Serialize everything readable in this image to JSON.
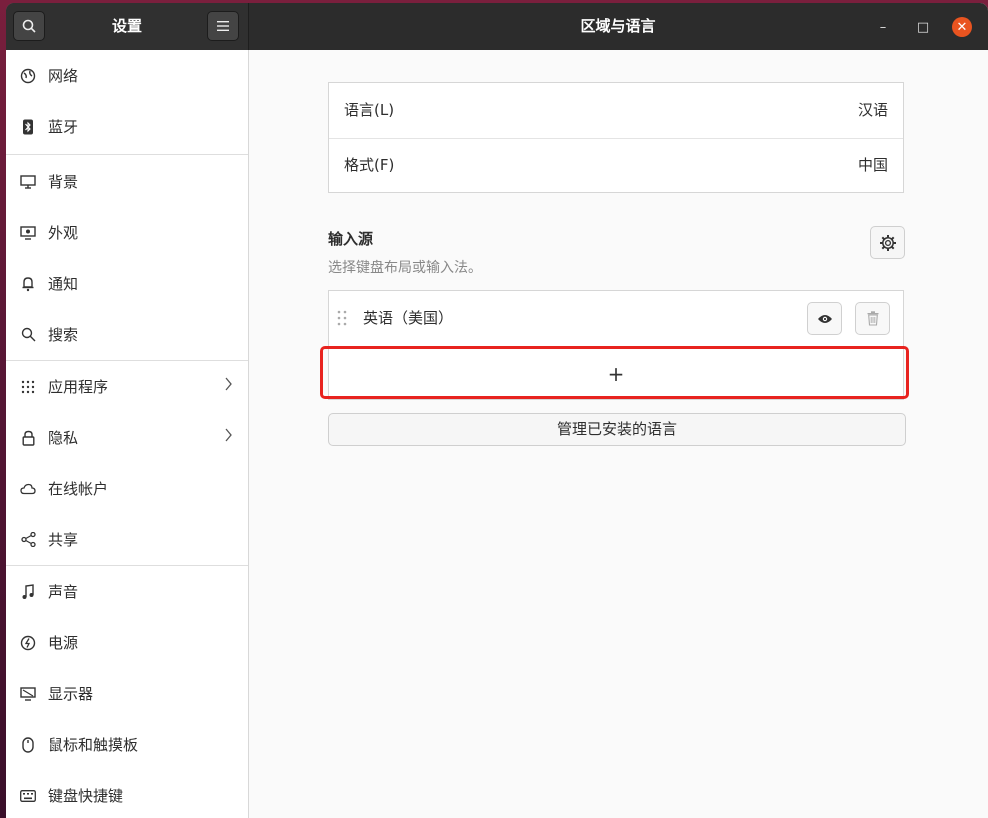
{
  "header": {
    "sidebar_title": "设置",
    "main_title": "区域与语言",
    "search_icon": "search-icon",
    "menu_icon": "hamburger-menu-icon",
    "minimize": "–",
    "maximize": "□",
    "close": "✕",
    "close_color": "#e95420"
  },
  "sidebar": {
    "items": [
      {
        "label": "网络",
        "icon": "network-globe-icon"
      },
      {
        "label": "蓝牙",
        "icon": "bluetooth-icon"
      },
      {
        "label": "背景",
        "icon": "background-monitor-icon"
      },
      {
        "label": "外观",
        "icon": "appearance-icon"
      },
      {
        "label": "通知",
        "icon": "bell-icon"
      },
      {
        "label": "搜索",
        "icon": "search-icon"
      },
      {
        "label": "应用程序",
        "icon": "apps-grid-icon"
      },
      {
        "label": "隐私",
        "icon": "lock-icon"
      },
      {
        "label": "在线帐户",
        "icon": "cloud-icon"
      },
      {
        "label": "共享",
        "icon": "share-icon"
      },
      {
        "label": "声音",
        "icon": "music-note-icon"
      },
      {
        "label": "电源",
        "icon": "power-icon"
      },
      {
        "label": "显示器",
        "icon": "display-icon"
      },
      {
        "label": "鼠标和触摸板",
        "icon": "mouse-icon"
      },
      {
        "label": "键盘快捷键",
        "icon": "keyboard-icon"
      }
    ]
  },
  "region": {
    "language_label": "语言(L)",
    "language_value": "汉语",
    "formats_label": "格式(F)",
    "formats_value": "中国"
  },
  "input_sources": {
    "title": "输入源",
    "subtitle": "选择键盘布局或输入法。",
    "sources": [
      {
        "name": "英语（美国）"
      }
    ],
    "add_label": "+",
    "manage_button": "管理已安装的语言"
  },
  "accent": {
    "highlight": "#e8231f"
  }
}
